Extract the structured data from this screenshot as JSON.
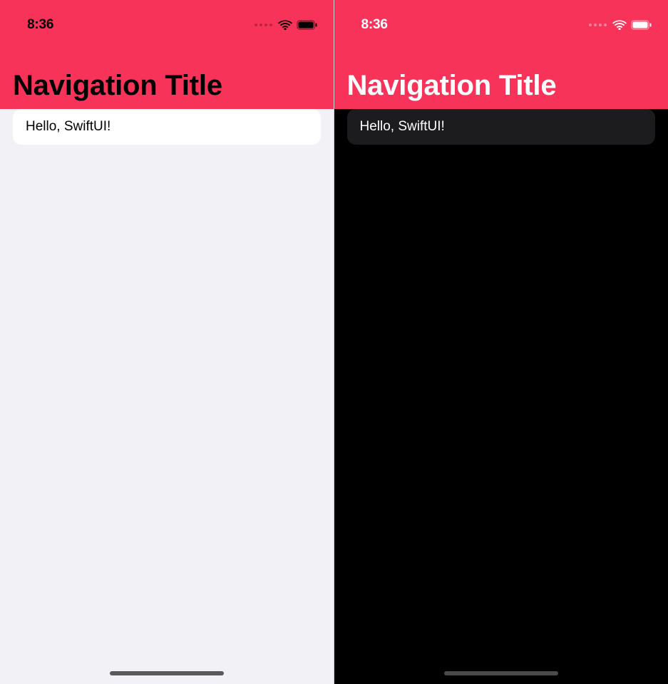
{
  "accentColor": "#f73359",
  "light": {
    "status": {
      "time": "8:36"
    },
    "nav": {
      "title": "Navigation Title"
    },
    "list": {
      "items": [
        "Hello, SwiftUI!"
      ]
    }
  },
  "dark": {
    "status": {
      "time": "8:36"
    },
    "nav": {
      "title": "Navigation Title"
    },
    "list": {
      "items": [
        "Hello, SwiftUI!"
      ]
    }
  }
}
